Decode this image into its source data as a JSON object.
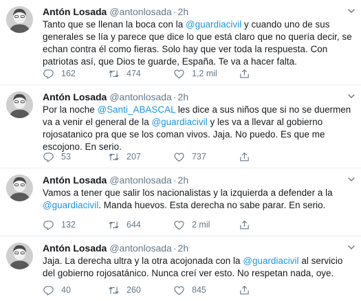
{
  "tweets": [
    {
      "name": "Antón Losada",
      "handle": "@antonlosada",
      "dot": "·",
      "time": "2h",
      "text": [
        {
          "t": "Tanto que se llenan la boca con la "
        },
        {
          "t": "@guardiacivil",
          "mention": true
        },
        {
          "t": " y cuando uno de sus generales se lía y parece que dice lo que está claro que no quería decir, se echan contra él como fieras. Solo hay que ver toda la respuesta. Con patriotas así, que Dios te guarde, España. Te va a hacer falta."
        }
      ],
      "replies": "162",
      "retweets": "474",
      "likes": "1,2 mil"
    },
    {
      "name": "Antón Losada",
      "handle": "@antonlosada",
      "dot": "·",
      "time": "2h",
      "text": [
        {
          "t": "Por la noche "
        },
        {
          "t": "@Santi_ABASCAL",
          "mention": true
        },
        {
          "t": " les dice a sus niños que si no se duermen va a venir el general de la "
        },
        {
          "t": "@guardiacivil",
          "mention": true
        },
        {
          "t": " y les va a llevar al gobierno rojosatanico pra que se los coman vivos. Jaja. No puedo. Es que me escojono. En serio."
        }
      ],
      "replies": "53",
      "retweets": "207",
      "likes": "737"
    },
    {
      "name": "Antón Losada",
      "handle": "@antonlosada",
      "dot": "·",
      "time": "2h",
      "text": [
        {
          "t": "Vamos a tener que salir los nacionalistas y la izquierda a defender a la "
        },
        {
          "t": "@guardiacivil",
          "mention": true
        },
        {
          "t": ". Manda huevos. Esta derecha no sabe parar. En serio."
        }
      ],
      "replies": "132",
      "retweets": "644",
      "likes": "2 mil"
    },
    {
      "name": "Antón Losada",
      "handle": "@antonlosada",
      "dot": "·",
      "time": "2h",
      "text": [
        {
          "t": "Jaja. La derecha ultra y la otra acojonada con la "
        },
        {
          "t": "@guardiacivil",
          "mention": true
        },
        {
          "t": " al servicio del gobierno rojosatánico. Nunca creí ver esto. No respetan nada, oye."
        }
      ],
      "replies": "40",
      "retweets": "260",
      "likes": "845"
    }
  ],
  "icons": {
    "reply": "reply-icon",
    "retweet": "retweet-icon",
    "like": "heart-icon",
    "share": "share-icon",
    "menu": "chevron-down-icon"
  },
  "colors": {
    "mention": "#1b95e0",
    "secondary": "#657786",
    "text": "#14171a",
    "divider": "#e6ecf0"
  }
}
